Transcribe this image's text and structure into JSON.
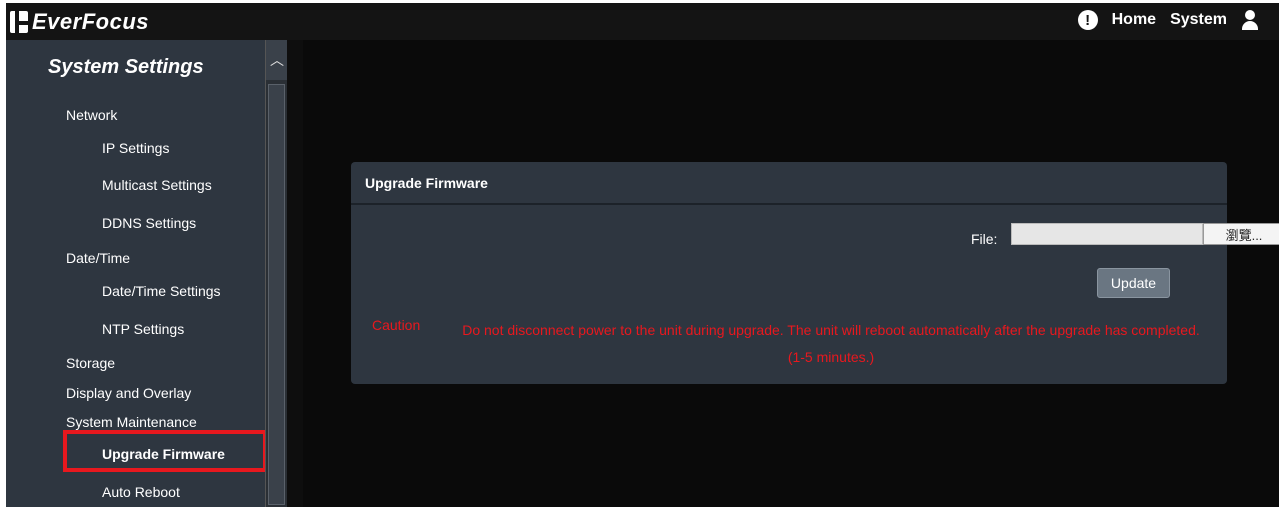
{
  "header": {
    "brand": "EverFocus",
    "nav": {
      "home": "Home",
      "system": "System"
    },
    "icons": {
      "info": "alert-icon",
      "user": "user-icon"
    }
  },
  "sidebar": {
    "title": "System Settings",
    "items": [
      {
        "label": "Network",
        "level": 1
      },
      {
        "label": "IP Settings",
        "level": 2
      },
      {
        "label": "Multicast Settings",
        "level": 2
      },
      {
        "label": "DDNS Settings",
        "level": 2
      },
      {
        "label": "Date/Time",
        "level": 1
      },
      {
        "label": "Date/Time Settings",
        "level": 2
      },
      {
        "label": "NTP Settings",
        "level": 2
      },
      {
        "label": "Storage",
        "level": 1
      },
      {
        "label": "Display and Overlay",
        "level": 1
      },
      {
        "label": "System Maintenance",
        "level": 1
      },
      {
        "label": "Upgrade Firmware",
        "level": 2,
        "selected": true
      },
      {
        "label": "Auto Reboot",
        "level": 2
      }
    ]
  },
  "panel": {
    "title": "Upgrade Firmware",
    "file_label": "File:",
    "file_value": "",
    "browse_label": "瀏覽...",
    "update_label": "Update",
    "caution_label": "Caution",
    "caution_text": "Do not disconnect power to the unit during upgrade. The unit will reboot automatically after the upgrade has completed. (1-5 minutes.)"
  },
  "colors": {
    "background": "#0a0a0a",
    "sidebar": "#2e3640",
    "panel": "#2e3640",
    "caution": "#e8181e",
    "highlight": "#e8181e"
  }
}
